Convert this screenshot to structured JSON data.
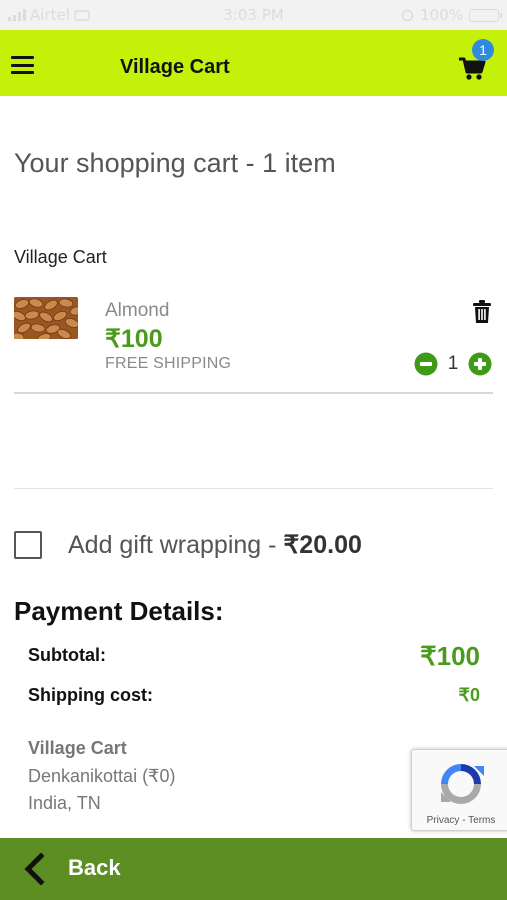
{
  "status_bar": {
    "carrier": "Airtel",
    "time": "3:03 PM",
    "battery": "100%"
  },
  "header": {
    "title": "Village Cart",
    "cart_count": "1"
  },
  "cart": {
    "heading": "Your shopping cart - 1 item",
    "store": "Village Cart",
    "items": [
      {
        "name": "Almond",
        "price": "₹100",
        "shipping": "FREE SHIPPING",
        "quantity": "1"
      }
    ]
  },
  "gift": {
    "label": "Add gift wrapping - ",
    "price": "₹20.00"
  },
  "payment": {
    "heading": "Payment Details:",
    "subtotal_label": "Subtotal:",
    "subtotal_value": "₹100",
    "shipping_label": "Shipping cost:",
    "shipping_value": "₹0"
  },
  "address": {
    "name": "Village Cart",
    "line1": "Denkanikottai (₹0)",
    "line2": "India, TN"
  },
  "recaptcha": {
    "links": "Privacy - Terms"
  },
  "footer": {
    "back_label": "Back"
  },
  "colors": {
    "header_bg": "#c3f208",
    "accent_green": "#4a9a1c",
    "footer_bg": "#5d8e23",
    "badge_blue": "#2f8be0"
  }
}
